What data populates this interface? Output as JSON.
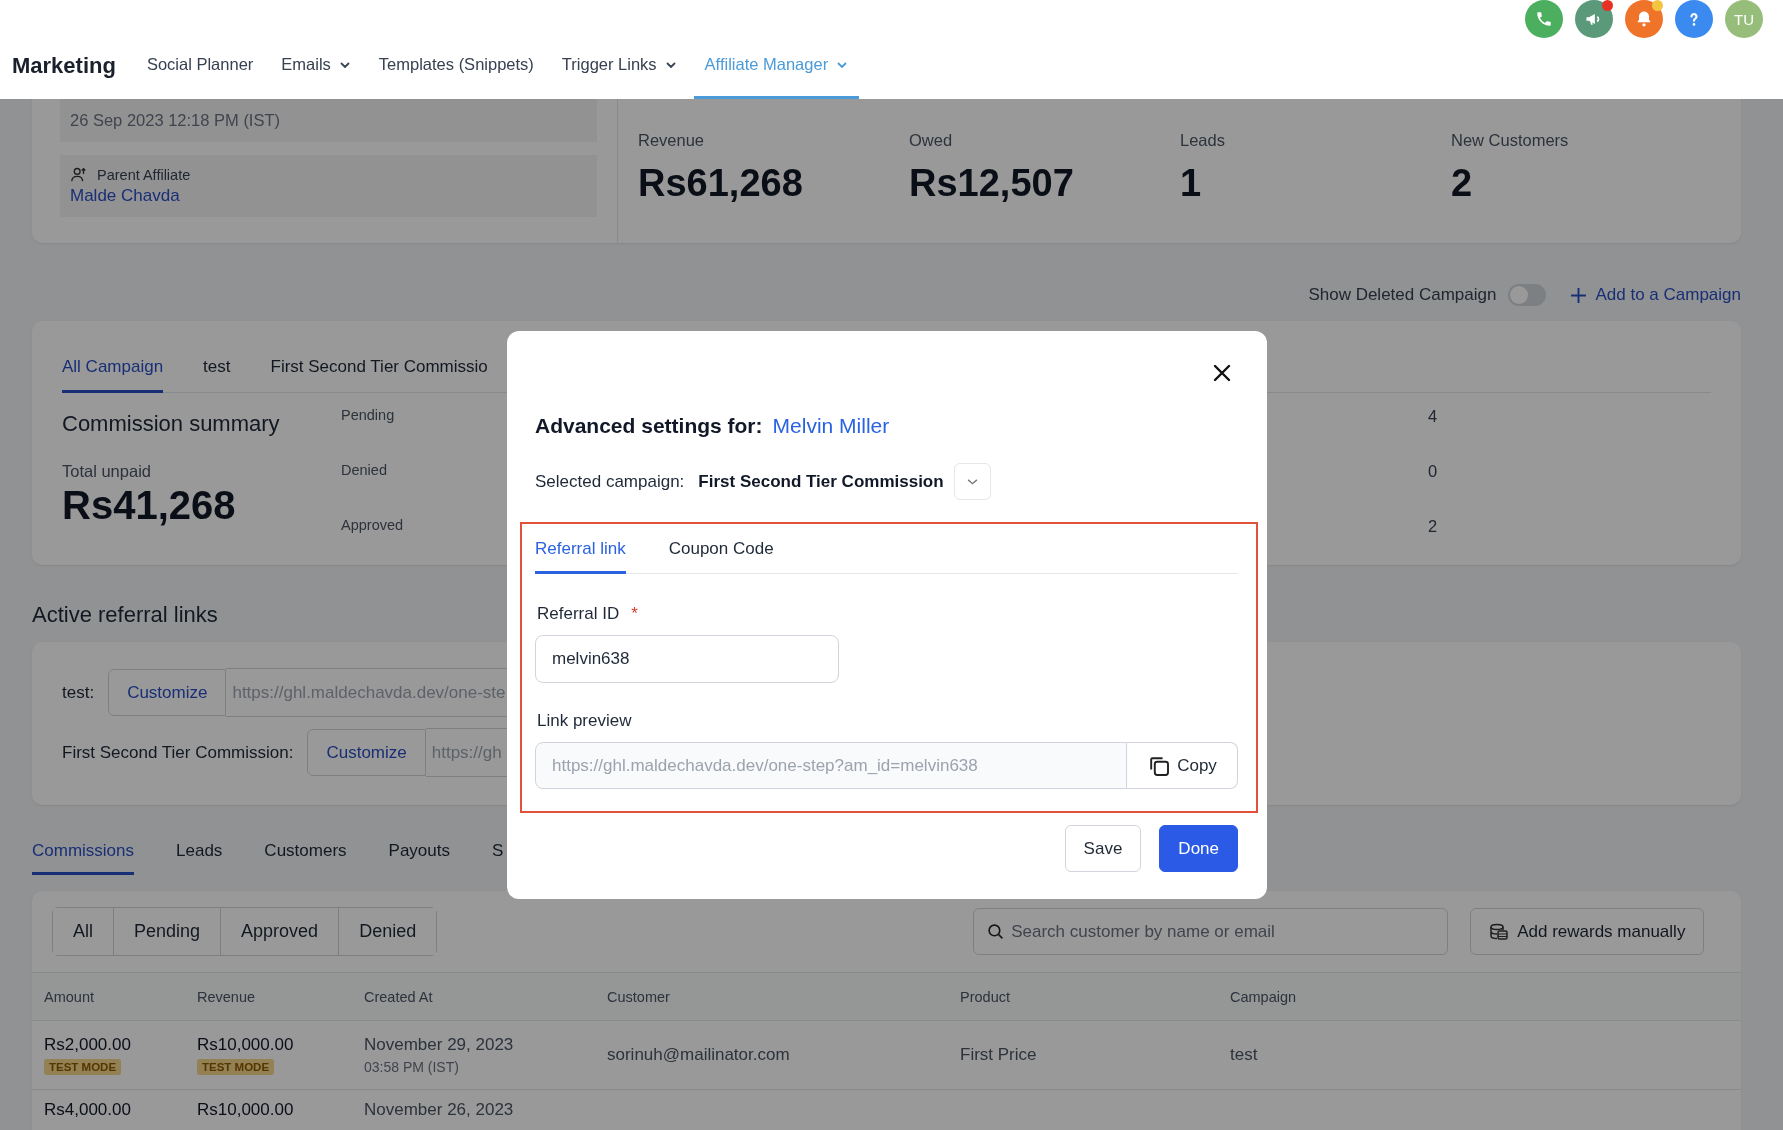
{
  "header": {
    "title": "Marketing",
    "nav": [
      {
        "label": "Social Planner",
        "dropdown": false,
        "selected": false
      },
      {
        "label": "Emails",
        "dropdown": true,
        "selected": false
      },
      {
        "label": "Templates (Snippets)",
        "dropdown": false,
        "selected": false
      },
      {
        "label": "Trigger Links",
        "dropdown": true,
        "selected": false
      },
      {
        "label": "Affiliate Manager",
        "dropdown": true,
        "selected": true
      }
    ],
    "icons": [
      {
        "kind": "phone"
      },
      {
        "kind": "megaphone",
        "color": "#e53224"
      },
      {
        "kind": "bell",
        "color": "#f4c542"
      },
      {
        "kind": "help"
      }
    ],
    "avatar": "TU"
  },
  "affiliate": {
    "joined_date": "26 Sep 2023 12:18 PM (IST)",
    "parent_label": "Parent Affiliate",
    "parent_name": "Malde Chavda"
  },
  "stats": [
    {
      "label": "Revenue",
      "value": "Rs61,268"
    },
    {
      "label": "Owed",
      "value": "Rs12,507"
    },
    {
      "label": "Leads",
      "value": "1"
    },
    {
      "label": "New Customers",
      "value": "2"
    }
  ],
  "show_deleted": {
    "label": "Show Deleted Campaign",
    "on": false
  },
  "add_campaign": "Add to a Campaign",
  "campaign_tabs": [
    {
      "label": "All Campaign",
      "selected": true
    },
    {
      "label": "test",
      "selected": false
    },
    {
      "label": "First Second Tier Commissio",
      "selected": false
    }
  ],
  "commission_summary": {
    "title": "Commission summary",
    "total_label": "Total unpaid",
    "total": "Rs41,268",
    "statuses": [
      {
        "label": "Pending",
        "count": "4"
      },
      {
        "label": "Denied",
        "count": "0"
      },
      {
        "label": "Approved",
        "count": "2"
      }
    ]
  },
  "referral_links": {
    "title": "Active referral links",
    "rows": [
      {
        "label": "test:",
        "button": "Customize",
        "url": "https://ghl.maldechavda.dev/one-ste"
      },
      {
        "label": "First Second Tier Commission:",
        "button": "Customize",
        "url": "https://gh"
      }
    ]
  },
  "bottom_tabs": [
    {
      "label": "Commissions",
      "selected": true
    },
    {
      "label": "Leads",
      "selected": false
    },
    {
      "label": "Customers",
      "selected": false
    },
    {
      "label": "Payouts",
      "selected": false
    },
    {
      "label": "S",
      "selected": false
    }
  ],
  "filters": [
    "All",
    "Pending",
    "Approved",
    "Denied"
  ],
  "search": {
    "placeholder": "Search customer by name or email"
  },
  "add_rewards": "Add rewards manually",
  "table": {
    "columns": [
      "Amount",
      "Revenue",
      "Created At",
      "Customer",
      "Product",
      "Campaign"
    ],
    "rows": [
      {
        "amount": "Rs2,000.00",
        "amount_badge": "TEST MODE",
        "revenue": "Rs10,000.00",
        "revenue_badge": "TEST MODE",
        "created": "November 29, 2023",
        "created_time": "03:58 PM (IST)",
        "customer": "sorinuh@mailinator.com",
        "product": "First Price",
        "campaign": "test"
      },
      {
        "amount": "Rs4,000.00",
        "revenue": "Rs10,000.00",
        "created": "November 26, 2023"
      }
    ]
  },
  "modal": {
    "title": "Advanced settings for:",
    "name": "Melvin Miller",
    "campaign_label": "Selected campaign:",
    "campaign": "First Second Tier Commission",
    "tabs": [
      {
        "label": "Referral link",
        "selected": true
      },
      {
        "label": "Coupon Code",
        "selected": false
      }
    ],
    "referral_id_label": "Referral ID",
    "required_mark": "*",
    "referral_id": "melvin638",
    "preview_label": "Link preview",
    "preview_url": "https://ghl.maldechavda.dev/one-step?am_id=melvin638",
    "copy": "Copy",
    "buttons": [
      {
        "label": "Save",
        "kind": "secondary"
      },
      {
        "label": "Done",
        "kind": "primary"
      }
    ]
  }
}
